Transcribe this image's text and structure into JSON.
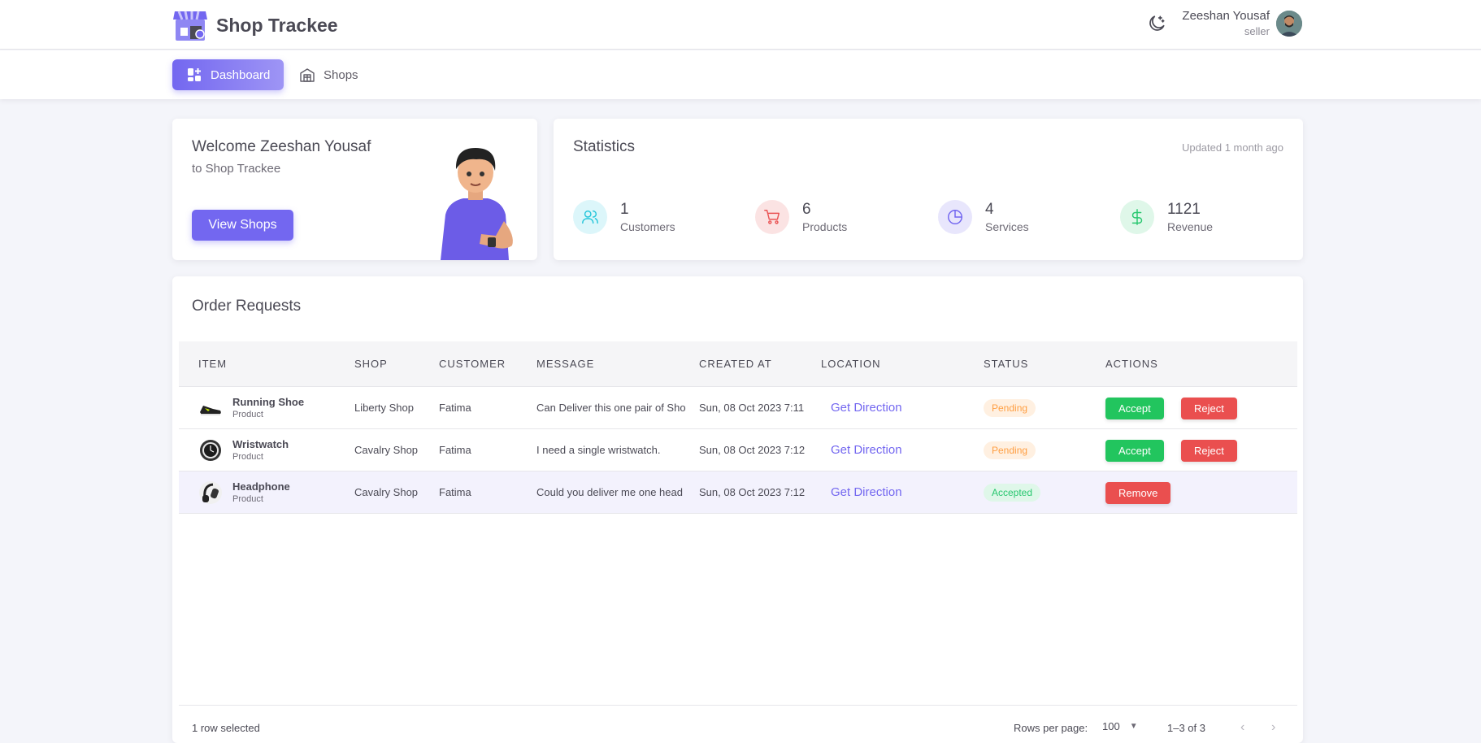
{
  "app": {
    "title": "Shop Trackee"
  },
  "user": {
    "name": "Zeeshan Yousaf",
    "role": "seller"
  },
  "nav": {
    "dashboard": "Dashboard",
    "shops": "Shops"
  },
  "welcome": {
    "title": "Welcome Zeeshan Yousaf",
    "subtitle": "to Shop Trackee",
    "button": "View Shops"
  },
  "stats": {
    "title": "Statistics",
    "updated": "Updated 1 month ago",
    "items": [
      {
        "value": "1",
        "label": "Customers",
        "icon": "users-icon",
        "color": "#26c6da"
      },
      {
        "value": "6",
        "label": "Products",
        "icon": "cart-icon",
        "color": "#ea5455"
      },
      {
        "value": "4",
        "label": "Services",
        "icon": "pie-chart-icon",
        "color": "#7367f0"
      },
      {
        "value": "1121",
        "label": "Revenue",
        "icon": "dollar-icon",
        "color": "#28c76f"
      }
    ]
  },
  "orders": {
    "title": "Order Requests",
    "columns": [
      "Item",
      "Shop",
      "Customer",
      "Message",
      "Created At",
      "Location",
      "Status",
      "Actions"
    ],
    "rows": [
      {
        "item": "Running Shoe",
        "type": "Product",
        "shop": "Liberty Shop",
        "customer": "Fatima",
        "message": "Can Deliver this one pair of Sho",
        "created": "Sun, 08 Oct 2023 7:11",
        "location": "Get Direction",
        "status": "Pending"
      },
      {
        "item": "Wristwatch",
        "type": "Product",
        "shop": "Cavalry Shop",
        "customer": "Fatima",
        "message": "I need a single wristwatch.",
        "created": "Sun, 08 Oct 2023 7:12",
        "location": "Get Direction",
        "status": "Pending"
      },
      {
        "item": "Headphone",
        "type": "Product",
        "shop": "Cavalry Shop",
        "customer": "Fatima",
        "message": "Could you deliver me one head",
        "created": "Sun, 08 Oct 2023 7:12",
        "location": "Get Direction",
        "status": "Accepted"
      }
    ],
    "actions": {
      "accept": "Accept",
      "reject": "Reject",
      "remove": "Remove"
    },
    "footer": {
      "selected": "1 row selected",
      "rows_per_page_label": "Rows per page:",
      "rows_per_page": "100",
      "range": "1–3 of 3"
    }
  },
  "colors": {
    "primary": "#7367f0",
    "accept": "#22c55e",
    "reject": "#ea4f4f"
  }
}
